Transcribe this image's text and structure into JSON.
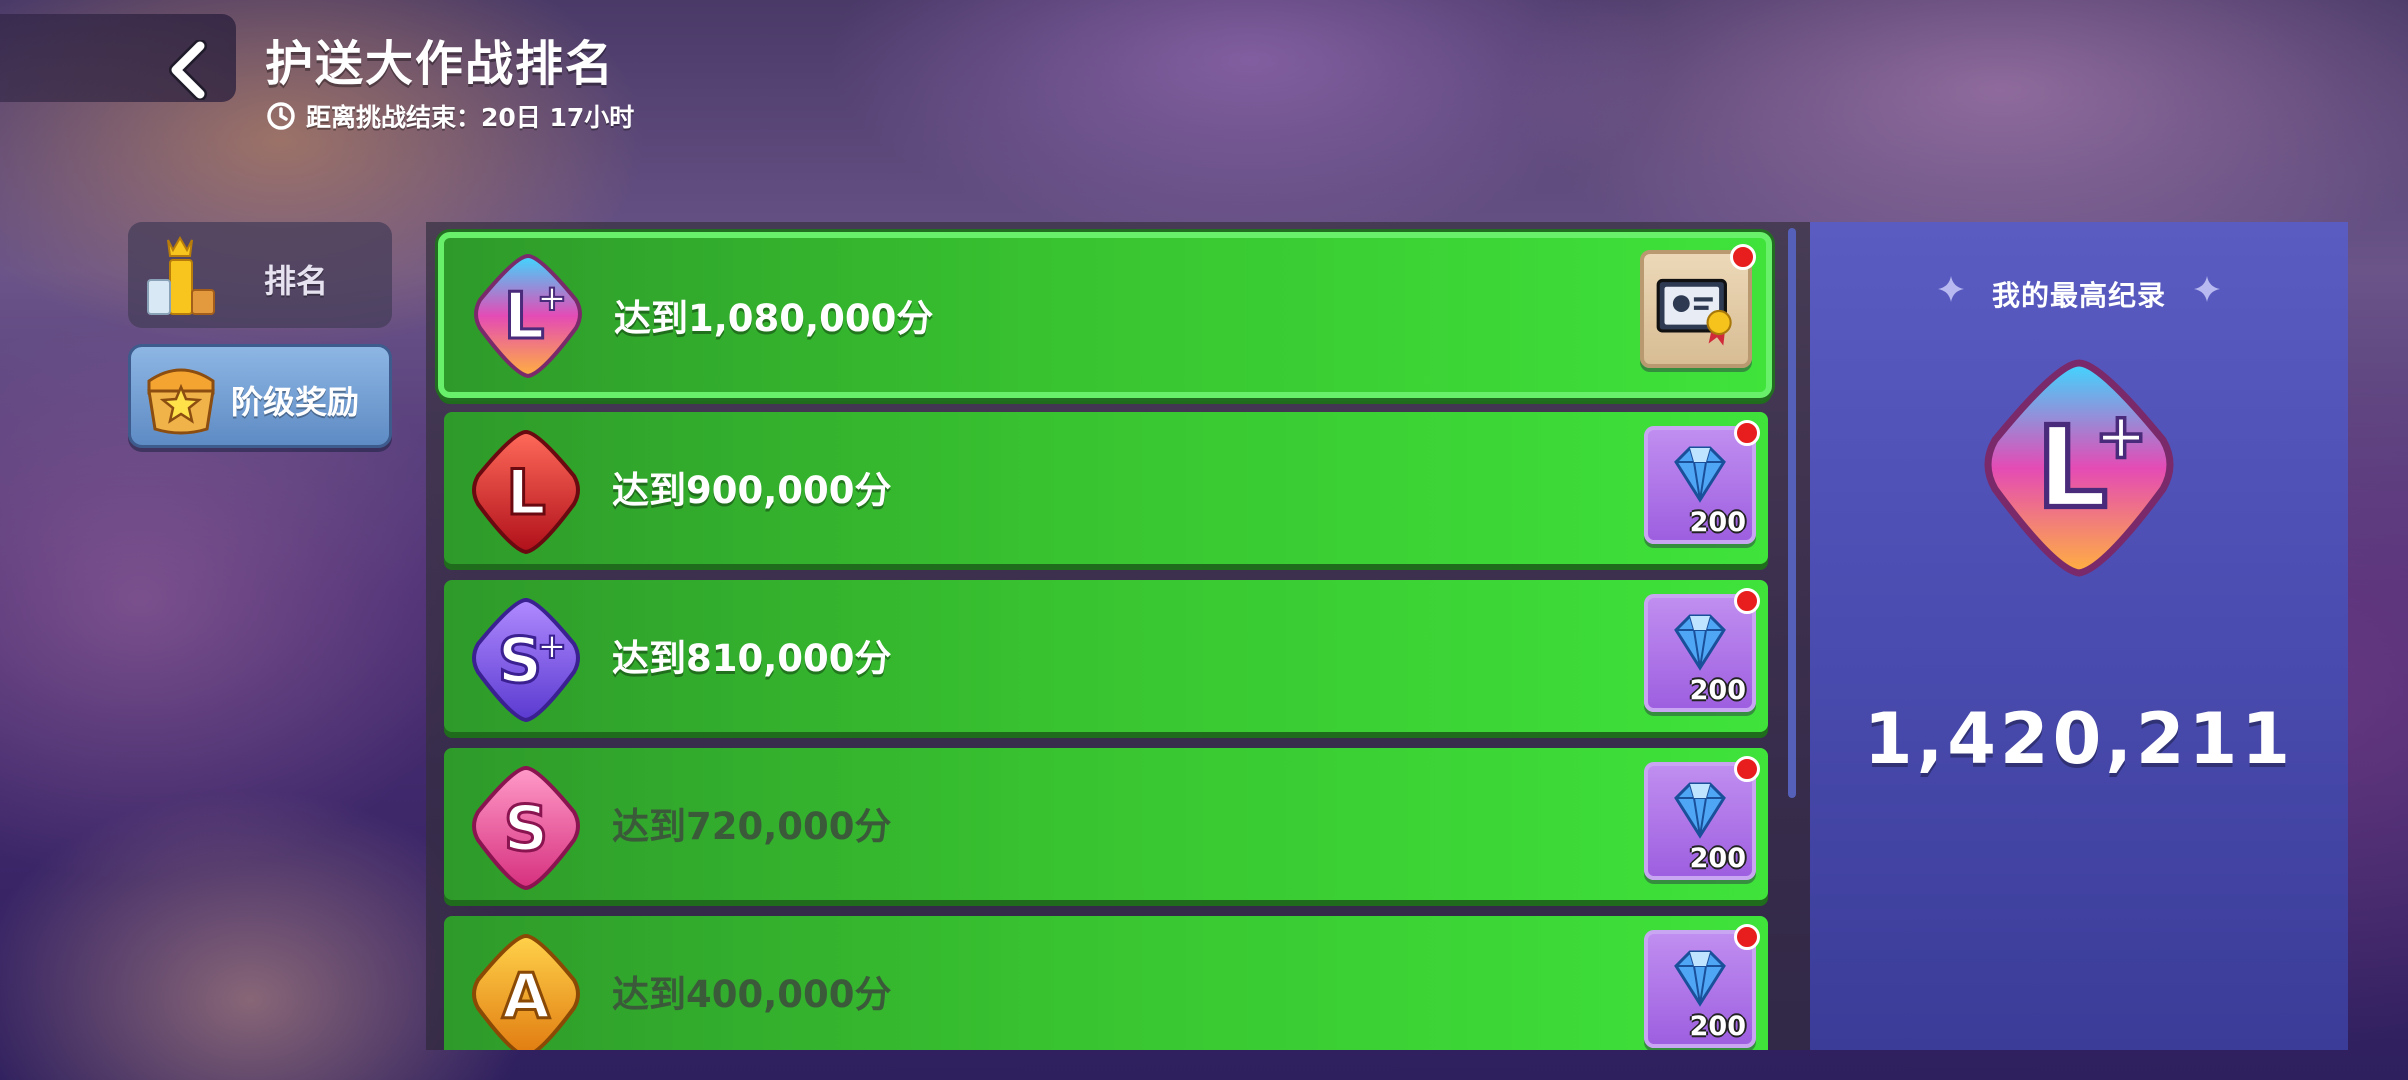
{
  "header": {
    "title": "护送大作战排名",
    "countdown_label": "距离挑战结束：",
    "countdown_value": "20日 17小时"
  },
  "sidebar": {
    "tabs": [
      {
        "label": "排名",
        "icon": "podium-crown-icon",
        "selected": false
      },
      {
        "label": "阶级奖励",
        "icon": "treasure-chest-star-icon",
        "selected": true
      }
    ]
  },
  "milestones": [
    {
      "label": "达到1,080,000分",
      "rank_icon": "rank-L-plus-icon",
      "reward_icon": "certificate-icon",
      "reward_count": "",
      "notification": true,
      "label_style": "light"
    },
    {
      "label": "达到900,000分",
      "rank_icon": "rank-L-icon",
      "reward_icon": "diamond-icon",
      "reward_count": "200",
      "notification": true,
      "label_style": "light"
    },
    {
      "label": "达到810,000分",
      "rank_icon": "rank-S-plus-icon",
      "reward_icon": "diamond-icon",
      "reward_count": "200",
      "notification": true,
      "label_style": "light"
    },
    {
      "label": "达到720,000分",
      "rank_icon": "rank-S-icon",
      "reward_icon": "diamond-icon",
      "reward_count": "200",
      "notification": true,
      "label_style": "dark"
    },
    {
      "label": "达到400,000分",
      "rank_icon": "rank-A-icon",
      "reward_icon": "diamond-icon",
      "reward_count": "200",
      "notification": true,
      "label_style": "dark"
    }
  ],
  "record": {
    "title": "我的最高纪录",
    "rank_icon": "rank-L-plus-icon",
    "score": "1,420,211"
  },
  "colors": {
    "row_green": "#3fe33a",
    "reward_purple": "#b07ae8",
    "record_panel": "#5a5cc2",
    "notification_red": "#e81d1d"
  }
}
